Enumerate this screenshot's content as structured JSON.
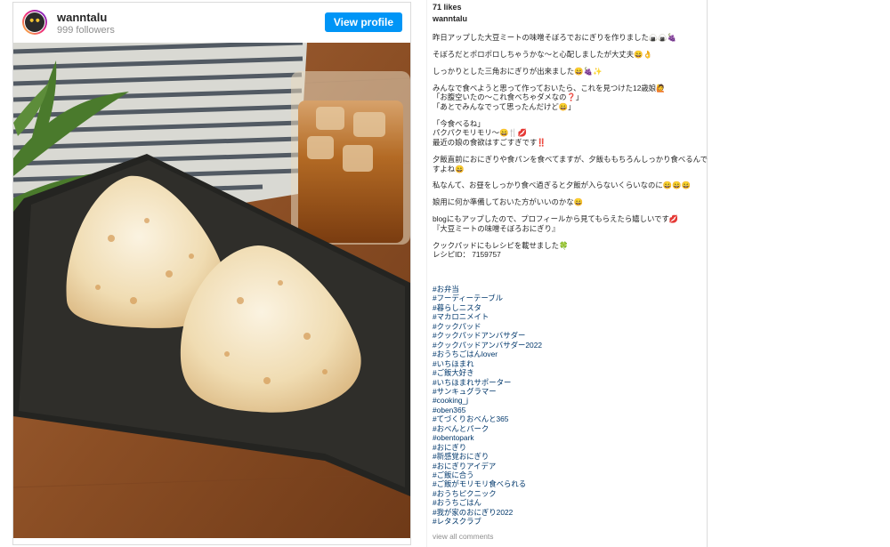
{
  "post": {
    "username": "wanntalu",
    "followers": "999 followers",
    "view_profile": "View profile",
    "photo_alt": "rice balls on a dark plate with iced tea"
  },
  "caption": {
    "likes": "71 likes",
    "username": "wanntalu",
    "lines": [
      "昨日アップした大豆ミートの味噌そぼろでおにぎりを作りました🍙🍙🍇",
      "",
      "そぼろだとポロポロしちゃうかな〜と心配しましたが大丈夫😄👌",
      "",
      "しっかりとした三角おにぎりが出来ました😄🍇✨",
      "",
      "みんなで食べようと思って作っておいたら、これを見つけた12歳娘🙋",
      "「お腹空いたの〜これ食べちゃダメなの❓」",
      "「あとでみんなでって思ったんだけど😄」",
      "",
      "「今食べるね」",
      "パクパクモリモリ〜😄🍴💋",
      "最近の娘の食欲はすごすぎです‼️",
      "",
      "夕飯直前におにぎりや食パンを食べてますが、夕飯ももちろんしっかり食べるんで",
      "すよね😄",
      "",
      "私なんて、お昼をしっかり食べ過ぎると夕飯が入らないくらいなのに😄😄😄",
      "",
      "娘用に何か準備しておいた方がいいのかな😄",
      "",
      "blogにもアップしたので、プロフィールから見てもらえたら嬉しいです💋",
      "『大豆ミートの味噌そぼろおにぎり』",
      "",
      "クックパッドにもレシピを載せました🍀",
      "レシピID： 7159757"
    ],
    "hashtags": [
      "#お弁当",
      "#フーディーテーブル",
      "#暮らしニスタ",
      "#マカロニメイト",
      "#クックパッド",
      "#クックパッドアンバサダー",
      "#クックパッドアンバサダー2022",
      "#おうちごはんlover",
      "#いちほまれ",
      "#ご飯大好き",
      "#いちほまれサポーター",
      "#サンキュグラマー",
      "#cooking_j",
      "#oben365",
      "#てづくりおべんと365",
      "#おべんとパーク",
      "#obentopark",
      "#おにぎり",
      "#新感覚おにぎり",
      "#おにぎりアイデア",
      "#ご飯に合う",
      "#ご飯がモリモリ食べられる",
      "#おうちピクニック",
      "#おうちごはん",
      "#我が家のおにぎり2022",
      "#レタスクラブ"
    ],
    "view_all_comments": "view all comments"
  }
}
